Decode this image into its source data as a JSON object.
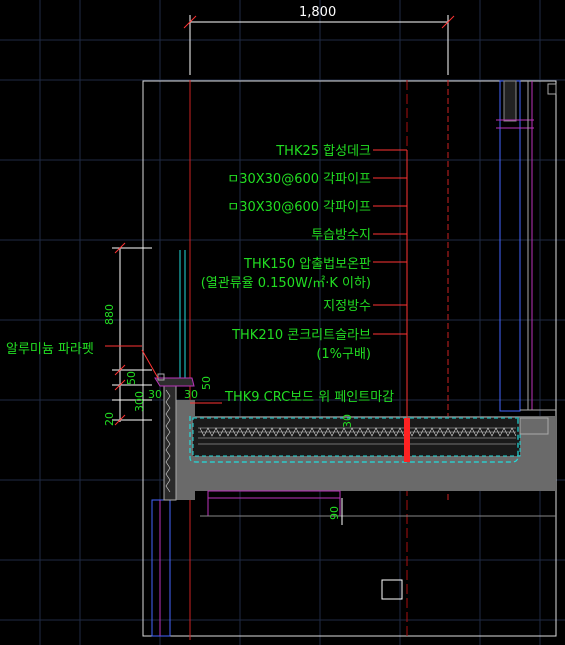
{
  "drawing": {
    "top_dimension": "1,800",
    "left_dimensions": [
      "880",
      "50",
      "300",
      "20"
    ],
    "small_dimensions": [
      "30",
      "30",
      "50",
      "30"
    ],
    "right_dimensions": [
      "90",
      "30"
    ],
    "parapet_label": "알루미늄 파라펫",
    "layer_labels": [
      "THK25 합성데크",
      "ㅁ30X30@600 각파이프",
      "ㅁ30X30@600 각파이프",
      "투습방수지",
      "THK150 압출법보온판",
      "(열관류율 0.150W/㎡·K 이하)",
      "지정방수",
      "THK210 콘크리트슬라브",
      "(1%구배)",
      "THK9 CRC보드 위 페인트마감"
    ]
  }
}
